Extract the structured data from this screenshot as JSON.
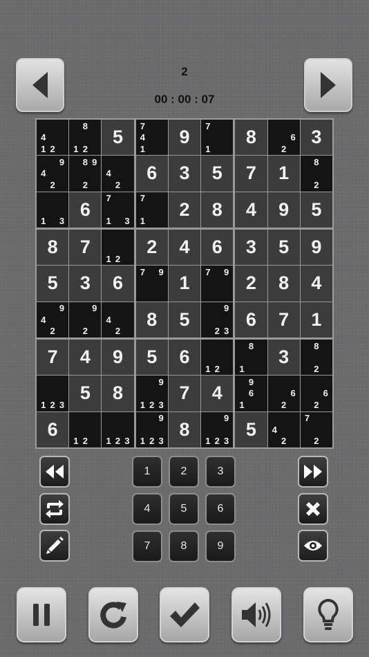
{
  "header": {
    "level": "2",
    "timer": "00 : 00 : 07"
  },
  "board": {
    "cells": [
      [
        {
          "c": [
            4,
            1,
            2
          ],
          "p": [
            3,
            6,
            7
          ]
        },
        {
          "c": [
            8,
            1,
            2
          ],
          "p": [
            1,
            6,
            7
          ]
        },
        {
          "v": 5
        },
        {
          "c": [
            7,
            4,
            1
          ],
          "p": [
            0,
            3,
            6
          ]
        },
        {
          "v": 9
        },
        {
          "c": [
            7,
            1
          ],
          "p": [
            0,
            6
          ]
        },
        {
          "v": 8
        },
        {
          "c": [
            6,
            2
          ],
          "p": [
            5,
            7
          ]
        },
        {
          "v": 3
        }
      ],
      [
        {
          "c": [
            9,
            4,
            2
          ],
          "p": [
            2,
            3,
            7
          ]
        },
        {
          "c": [
            8,
            9,
            2
          ],
          "p": [
            1,
            2,
            7
          ]
        },
        {
          "c": [
            4,
            2
          ],
          "p": [
            3,
            7
          ]
        },
        {
          "v": 6
        },
        {
          "v": 3
        },
        {
          "v": 5
        },
        {
          "v": 7
        },
        {
          "v": 1
        },
        {
          "c": [
            8,
            2
          ],
          "p": [
            1,
            7
          ]
        }
      ],
      [
        {
          "c": [
            1,
            3
          ],
          "p": [
            6,
            8
          ]
        },
        {
          "v": 6
        },
        {
          "c": [
            7,
            1,
            3
          ],
          "p": [
            0,
            6,
            8
          ]
        },
        {
          "c": [
            7,
            1
          ],
          "p": [
            0,
            6
          ]
        },
        {
          "v": 2
        },
        {
          "v": 8
        },
        {
          "v": 4
        },
        {
          "v": 9
        },
        {
          "v": 5
        }
      ],
      [
        {
          "v": 8
        },
        {
          "v": 7
        },
        {
          "c": [
            1,
            2
          ],
          "p": [
            6,
            7
          ]
        },
        {
          "v": 2
        },
        {
          "v": 4
        },
        {
          "v": 6
        },
        {
          "v": 3
        },
        {
          "v": 5
        },
        {
          "v": 9
        }
      ],
      [
        {
          "v": 5
        },
        {
          "v": 3
        },
        {
          "v": 6
        },
        {
          "c": [
            7,
            9
          ],
          "p": [
            0,
            2
          ]
        },
        {
          "v": 1
        },
        {
          "c": [
            7,
            9
          ],
          "p": [
            0,
            2
          ]
        },
        {
          "v": 2
        },
        {
          "v": 8
        },
        {
          "v": 4
        }
      ],
      [
        {
          "c": [
            9,
            4,
            2
          ],
          "p": [
            2,
            3,
            7
          ]
        },
        {
          "c": [
            9,
            2
          ],
          "p": [
            2,
            7
          ]
        },
        {
          "c": [
            4,
            2
          ],
          "p": [
            3,
            7
          ]
        },
        {
          "v": 8
        },
        {
          "v": 5
        },
        {
          "c": [
            9,
            2,
            3
          ],
          "p": [
            2,
            7,
            8
          ]
        },
        {
          "v": 6
        },
        {
          "v": 7
        },
        {
          "v": 1
        }
      ],
      [
        {
          "v": 7
        },
        {
          "v": 4
        },
        {
          "v": 9
        },
        {
          "v": 5
        },
        {
          "v": 6
        },
        {
          "c": [
            1,
            2
          ],
          "p": [
            6,
            7
          ]
        },
        {
          "c": [
            8,
            1
          ],
          "p": [
            1,
            6
          ]
        },
        {
          "v": 3
        },
        {
          "c": [
            8,
            2
          ],
          "p": [
            1,
            7
          ]
        }
      ],
      [
        {
          "c": [
            1,
            2,
            3
          ],
          "p": [
            6,
            7,
            8
          ]
        },
        {
          "v": 5
        },
        {
          "v": 8
        },
        {
          "c": [
            9,
            1,
            2,
            3
          ],
          "p": [
            2,
            6,
            7,
            8
          ]
        },
        {
          "v": 7
        },
        {
          "v": 4
        },
        {
          "c": [
            9,
            6,
            1
          ],
          "p": [
            1,
            4,
            6
          ]
        },
        {
          "c": [
            6,
            2
          ],
          "p": [
            5,
            7
          ]
        },
        {
          "c": [
            6,
            2
          ],
          "p": [
            5,
            7
          ]
        }
      ],
      [
        {
          "v": 6
        },
        {
          "c": [
            1,
            2
          ],
          "p": [
            6,
            7
          ]
        },
        {
          "c": [
            1,
            2,
            3
          ],
          "p": [
            6,
            7,
            8
          ]
        },
        {
          "c": [
            9,
            1,
            2,
            3
          ],
          "p": [
            2,
            6,
            7,
            8
          ]
        },
        {
          "v": 8
        },
        {
          "c": [
            9,
            1,
            2,
            3
          ],
          "p": [
            2,
            6,
            7,
            8
          ]
        },
        {
          "v": 5
        },
        {
          "c": [
            4,
            2
          ],
          "p": [
            3,
            7
          ]
        },
        {
          "c": [
            7,
            2
          ],
          "p": [
            0,
            7
          ]
        }
      ]
    ]
  },
  "numpad": [
    "1",
    "2",
    "3",
    "4",
    "5",
    "6",
    "7",
    "8",
    "9"
  ],
  "icons": {
    "prev": "triangle-left-icon",
    "next": "triangle-right-icon",
    "rewind": "rewind-icon",
    "forward": "fast-forward-icon",
    "swap": "repeat-icon",
    "erase": "x-icon",
    "pencil": "pencil-icon",
    "reveal": "eye-icon",
    "pause": "pause-icon",
    "restart": "restart-icon",
    "check": "check-icon",
    "sound": "speaker-icon",
    "hint": "lightbulb-icon"
  },
  "colors": {
    "given_cell": "#3c3c3c",
    "empty_cell": "#141414",
    "digit": "#f2f2f2"
  }
}
